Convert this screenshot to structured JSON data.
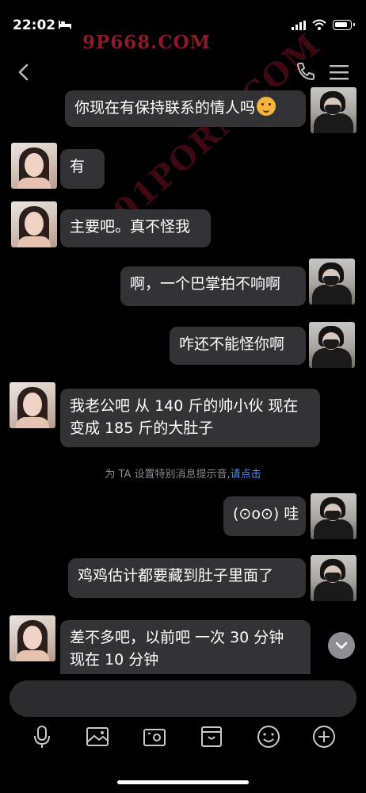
{
  "status_bar": {
    "time": "22:02"
  },
  "watermark": {
    "top": "9P668.COM",
    "diagonal": "91PORN.COM"
  },
  "messages": [
    {
      "side": "right",
      "text": "你现在有保持联系的情人吗"
    },
    {
      "side": "left",
      "text": "有"
    },
    {
      "side": "left",
      "text": "主要吧。真不怪我"
    },
    {
      "side": "right",
      "text": "啊，一个巴掌拍不响啊"
    },
    {
      "side": "right",
      "text": "咋还不能怪你啊"
    },
    {
      "side": "left",
      "lines": [
        "我老公吧 从 140 斤的帅小伙 现在",
        "变成 185 斤的大肚子"
      ]
    },
    {
      "side": "right",
      "text": "(⊙o⊙) 哇"
    },
    {
      "side": "right",
      "text": "鸡鸡估计都要藏到肚子里面了"
    },
    {
      "side": "left",
      "lines": [
        "差不多吧，以前吧 一次 30 分钟",
        "现在 10 分钟"
      ]
    }
  ],
  "notice": {
    "text": "为 TA 设置特别消息提示音,",
    "link": "请点击"
  },
  "colors": {
    "background": "#000000",
    "bubble": "#333335",
    "link": "#4a8ff0",
    "watermark": "#8b1a2a"
  },
  "icons": [
    "back-icon",
    "phone-icon",
    "menu-icon",
    "microphone-icon",
    "image-icon",
    "camera-icon",
    "sticker-icon",
    "emoji-icon",
    "plus-icon",
    "chevron-down-icon"
  ]
}
